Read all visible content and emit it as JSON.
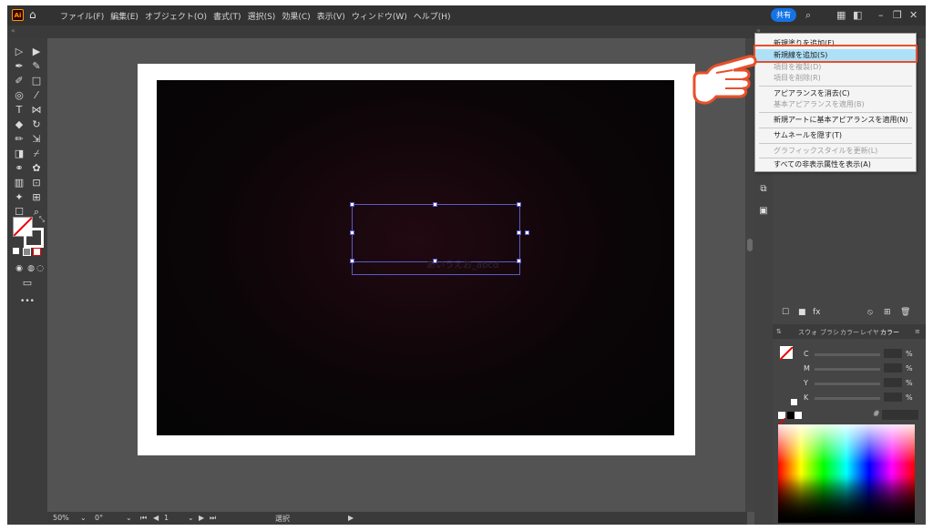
{
  "app": {
    "logo": "Ai",
    "home_icon": "home-icon"
  },
  "menu": [
    "ファイル(F)",
    "編集(E)",
    "オブジェクト(O)",
    "書式(T)",
    "選択(S)",
    "効果(C)",
    "表示(V)",
    "ウィンドウ(W)",
    "ヘルプ(H)"
  ],
  "topbar": {
    "share_label": "共有"
  },
  "canvas": {
    "ghost_text": "あいうえお_abcd"
  },
  "status": {
    "zoom": "50%",
    "rotation": "0°",
    "page": "1",
    "mode": "選択"
  },
  "color_panel": {
    "tabs": [
      "スウォ",
      "ブラシ",
      "カラー",
      "レイヤ",
      "カラー"
    ],
    "rows": [
      {
        "label": "C"
      },
      {
        "label": "M"
      },
      {
        "label": "Y"
      },
      {
        "label": "K"
      }
    ],
    "pct": "%",
    "hash": "#"
  },
  "flyout": {
    "items": [
      {
        "label": "新規塗りを追加(F)",
        "enabled": true
      },
      {
        "label": "新規線を追加(S)",
        "enabled": true,
        "highlighted": true
      },
      {
        "label": "項目を複製(D)",
        "enabled": false
      },
      {
        "label": "項目を削除(R)",
        "enabled": false
      },
      {
        "label": "アピアランスを消去(C)",
        "enabled": true
      },
      {
        "label": "基本アピアランスを適用(B)",
        "enabled": false
      },
      {
        "label": "新規アートに基本アピアランスを適用(N)",
        "enabled": true
      },
      {
        "label": "サムネールを隠す(T)",
        "enabled": true
      },
      {
        "label": "グラフィックスタイルを更新(L)",
        "enabled": false
      },
      {
        "label": "すべての非表示属性を表示(A)",
        "enabled": true
      }
    ]
  },
  "colors": {
    "highlight": "#aee1f8",
    "callout": "#e8502a",
    "share": "#1473e6"
  }
}
